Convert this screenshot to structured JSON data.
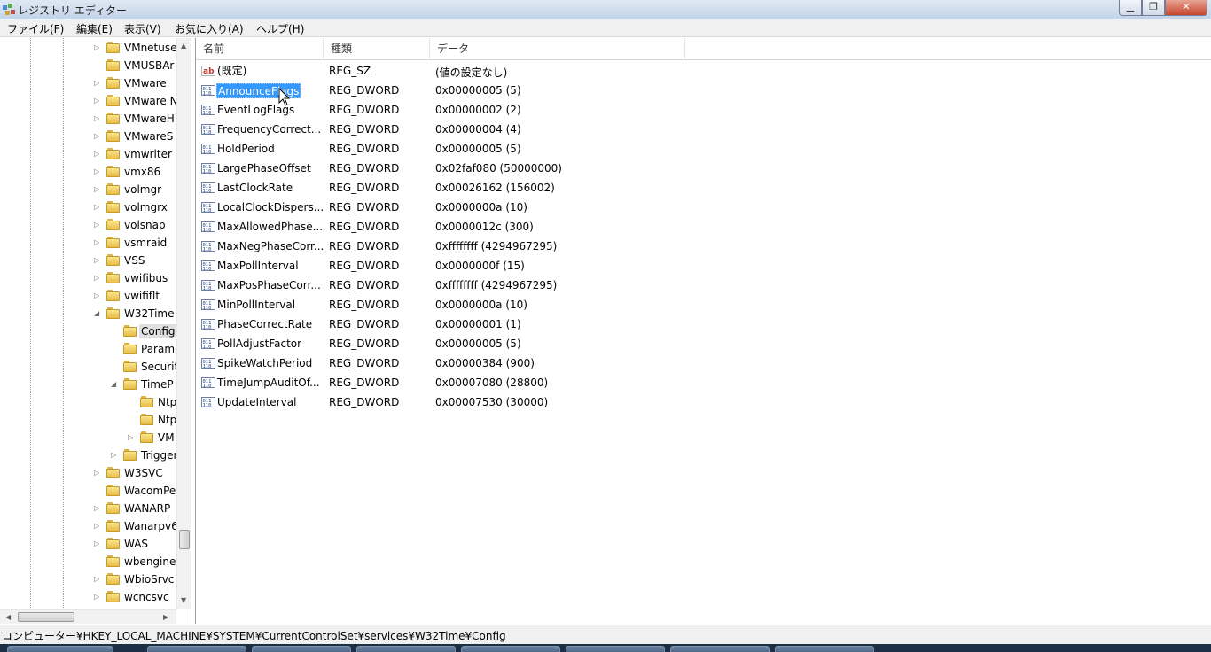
{
  "window": {
    "title": "レジストリ エディター",
    "icon": "regedit-icon",
    "controls": [
      "minimize-icon",
      "maximize-icon",
      "close-icon"
    ]
  },
  "menubar": [
    "ファイル(F)",
    "編集(E)",
    "表示(V)",
    "お気に入り(A)",
    "ヘルプ(H)"
  ],
  "tree": [
    {
      "label": "VMnetuse",
      "expander": "collapsed",
      "selected": false
    },
    {
      "label": "VMUSBAr",
      "expander": "none",
      "selected": false
    },
    {
      "label": "VMware",
      "expander": "collapsed",
      "selected": false
    },
    {
      "label": "VMware N",
      "expander": "collapsed",
      "selected": false
    },
    {
      "label": "VMwareH",
      "expander": "collapsed",
      "selected": false
    },
    {
      "label": "VMwareS",
      "expander": "collapsed",
      "selected": false
    },
    {
      "label": "vmwriter",
      "expander": "collapsed",
      "selected": false
    },
    {
      "label": "vmx86",
      "expander": "collapsed",
      "selected": false
    },
    {
      "label": "volmgr",
      "expander": "collapsed",
      "selected": false
    },
    {
      "label": "volmgrx",
      "expander": "collapsed",
      "selected": false
    },
    {
      "label": "volsnap",
      "expander": "collapsed",
      "selected": false
    },
    {
      "label": "vsmraid",
      "expander": "collapsed",
      "selected": false
    },
    {
      "label": "VSS",
      "expander": "collapsed",
      "selected": false
    },
    {
      "label": "vwifibus",
      "expander": "collapsed",
      "selected": false
    },
    {
      "label": "vwififlt",
      "expander": "collapsed",
      "selected": false
    },
    {
      "label": "W32Time",
      "expander": "expanded",
      "selected": false
    },
    {
      "label": "Config",
      "expander": "none",
      "selected": true
    },
    {
      "label": "Param",
      "expander": "none",
      "selected": false
    },
    {
      "label": "Securit",
      "expander": "none",
      "selected": false
    },
    {
      "label": "TimeP",
      "expander": "expanded",
      "selected": false
    },
    {
      "label": "Ntp",
      "expander": "none",
      "selected": false
    },
    {
      "label": "Ntp",
      "expander": "none",
      "selected": false
    },
    {
      "label": "VM",
      "expander": "collapsed",
      "selected": false
    },
    {
      "label": "Trigger",
      "expander": "collapsed",
      "selected": false
    },
    {
      "label": "W3SVC",
      "expander": "collapsed",
      "selected": false
    },
    {
      "label": "WacomPe",
      "expander": "none",
      "selected": false
    },
    {
      "label": "WANARP",
      "expander": "collapsed",
      "selected": false
    },
    {
      "label": "Wanarpv6",
      "expander": "collapsed",
      "selected": false
    },
    {
      "label": "WAS",
      "expander": "collapsed",
      "selected": false
    },
    {
      "label": "wbengine",
      "expander": "none",
      "selected": false
    },
    {
      "label": "WbioSrvc",
      "expander": "collapsed",
      "selected": false
    },
    {
      "label": "wcncsvc",
      "expander": "collapsed",
      "selected": false
    }
  ],
  "list": {
    "columns": [
      "名前",
      "種類",
      "データ"
    ],
    "rows": [
      {
        "name": "(既定)",
        "type": "REG_SZ",
        "data": "(値の設定なし)",
        "icon": "string-value-icon",
        "selected": false
      },
      {
        "name": "AnnounceFlags",
        "type": "REG_DWORD",
        "data": "0x00000005 (5)",
        "icon": "binary-value-icon",
        "selected": true
      },
      {
        "name": "EventLogFlags",
        "type": "REG_DWORD",
        "data": "0x00000002 (2)",
        "icon": "binary-value-icon",
        "selected": false
      },
      {
        "name": "FrequencyCorrect...",
        "type": "REG_DWORD",
        "data": "0x00000004 (4)",
        "icon": "binary-value-icon",
        "selected": false
      },
      {
        "name": "HoldPeriod",
        "type": "REG_DWORD",
        "data": "0x00000005 (5)",
        "icon": "binary-value-icon",
        "selected": false
      },
      {
        "name": "LargePhaseOffset",
        "type": "REG_DWORD",
        "data": "0x02faf080 (50000000)",
        "icon": "binary-value-icon",
        "selected": false
      },
      {
        "name": "LastClockRate",
        "type": "REG_DWORD",
        "data": "0x00026162 (156002)",
        "icon": "binary-value-icon",
        "selected": false
      },
      {
        "name": "LocalClockDispers...",
        "type": "REG_DWORD",
        "data": "0x0000000a (10)",
        "icon": "binary-value-icon",
        "selected": false
      },
      {
        "name": "MaxAllowedPhase...",
        "type": "REG_DWORD",
        "data": "0x0000012c (300)",
        "icon": "binary-value-icon",
        "selected": false
      },
      {
        "name": "MaxNegPhaseCorr...",
        "type": "REG_DWORD",
        "data": "0xffffffff (4294967295)",
        "icon": "binary-value-icon",
        "selected": false
      },
      {
        "name": "MaxPollInterval",
        "type": "REG_DWORD",
        "data": "0x0000000f (15)",
        "icon": "binary-value-icon",
        "selected": false
      },
      {
        "name": "MaxPosPhaseCorr...",
        "type": "REG_DWORD",
        "data": "0xffffffff (4294967295)",
        "icon": "binary-value-icon",
        "selected": false
      },
      {
        "name": "MinPollInterval",
        "type": "REG_DWORD",
        "data": "0x0000000a (10)",
        "icon": "binary-value-icon",
        "selected": false
      },
      {
        "name": "PhaseCorrectRate",
        "type": "REG_DWORD",
        "data": "0x00000001 (1)",
        "icon": "binary-value-icon",
        "selected": false
      },
      {
        "name": "PollAdjustFactor",
        "type": "REG_DWORD",
        "data": "0x00000005 (5)",
        "icon": "binary-value-icon",
        "selected": false
      },
      {
        "name": "SpikeWatchPeriod",
        "type": "REG_DWORD",
        "data": "0x00000384 (900)",
        "icon": "binary-value-icon",
        "selected": false
      },
      {
        "name": "TimeJumpAuditOf...",
        "type": "REG_DWORD",
        "data": "0x00007080 (28800)",
        "icon": "binary-value-icon",
        "selected": false
      },
      {
        "name": "UpdateInterval",
        "type": "REG_DWORD",
        "data": "0x00007530 (30000)",
        "icon": "binary-value-icon",
        "selected": false
      }
    ]
  },
  "status": {
    "path": "コンピューター¥HKEY_LOCAL_MACHINE¥SYSTEM¥CurrentControlSet¥services¥W32Time¥Config"
  },
  "colors": {
    "selection": "#3399ff",
    "folder": "#f0c850",
    "chrome": "#f0f0f0"
  }
}
